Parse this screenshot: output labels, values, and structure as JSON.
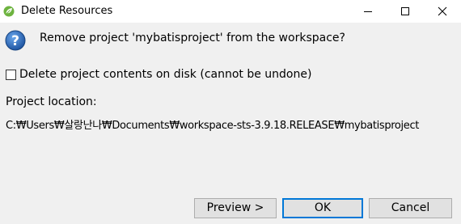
{
  "window": {
    "title": "Delete Resources",
    "icons": {
      "app": "spring-leaf-icon",
      "minimize": "minimize-icon",
      "maximize": "maximize-icon",
      "close": "close-icon"
    }
  },
  "dialog": {
    "question_icon": "question-icon",
    "question": "Remove project 'mybatisproject' from the workspace?",
    "checkbox": {
      "label": "Delete project contents on disk (cannot be undone)",
      "checked": false
    },
    "location_label": "Project location:",
    "location_path": "C:₩Users₩살랑난나₩Documents₩workspace-sts-3.9.18.RELEASE₩mybatisproject"
  },
  "buttons": {
    "preview": "Preview >",
    "ok": "OK",
    "cancel": "Cancel"
  },
  "colors": {
    "background": "#f0f0f0",
    "titlebar": "#ffffff",
    "spring_green": "#6db33f",
    "question_blue": "#1f5fb0",
    "default_button_border": "#0078d7"
  }
}
